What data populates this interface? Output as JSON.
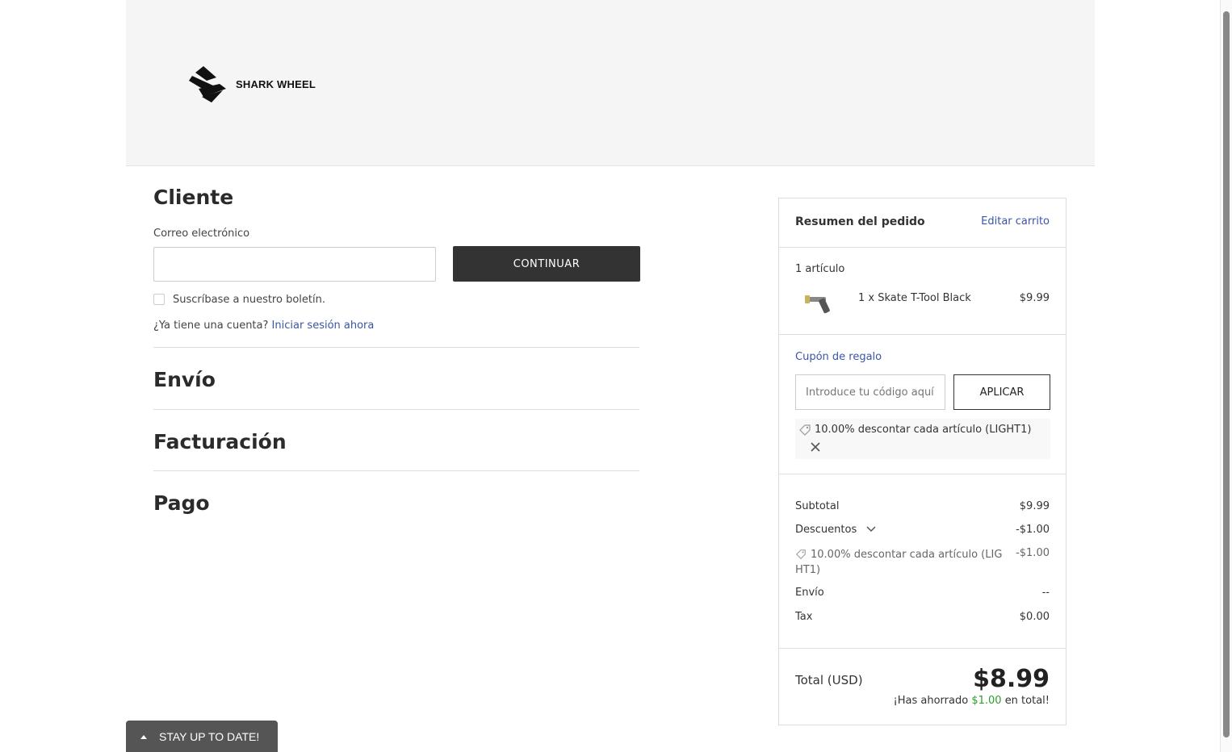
{
  "brand": {
    "name": "SHARK WHEEL"
  },
  "customer": {
    "heading": "Cliente",
    "email_label": "Correo electrónico",
    "email_value": "",
    "continue_label": "CONTINUAR",
    "newsletter_label": "Suscríbase a nuestro boletín.",
    "account_prompt": "¿Ya tiene una cuenta?",
    "signin_link": "Iniciar sesión ahora"
  },
  "sections": {
    "shipping": "Envío",
    "billing": "Facturación",
    "payment": "Pago"
  },
  "summary": {
    "title": "Resumen del pedido",
    "edit_cart": "Editar carrito",
    "item_count": "1 artículo",
    "item": {
      "name": "1 x Skate T-Tool Black",
      "price": "$9.99"
    },
    "coupon_toggle": "Cupón de regalo",
    "coupon_placeholder": "Introduce tu código aquí",
    "apply_label": "APLICAR",
    "applied_coupon": "10.00% descontar cada artículo (LIGHT1)",
    "subtotal_label": "Subtotal",
    "subtotal_value": "$9.99",
    "discounts_label": "Descuentos",
    "discounts_value": "-$1.00",
    "discount_line_label": "10.00% descontar cada artículo (LIGHT1)",
    "discount_line_value": "-$1.00",
    "shipping_label": "Envío",
    "shipping_value": "--",
    "tax_label": "Tax",
    "tax_value": "$0.00",
    "total_label": "Total (USD)",
    "total_value": "$8.99",
    "saved_prefix": "¡Has ahorrado",
    "saved_amount": "$1.00",
    "saved_suffix": "en total!"
  },
  "footer_widget": {
    "label": "STAY UP TO DATE!"
  },
  "colors": {
    "link": "#3a55a6",
    "button_dark": "#333333",
    "saved_green": "#2aa02a"
  }
}
